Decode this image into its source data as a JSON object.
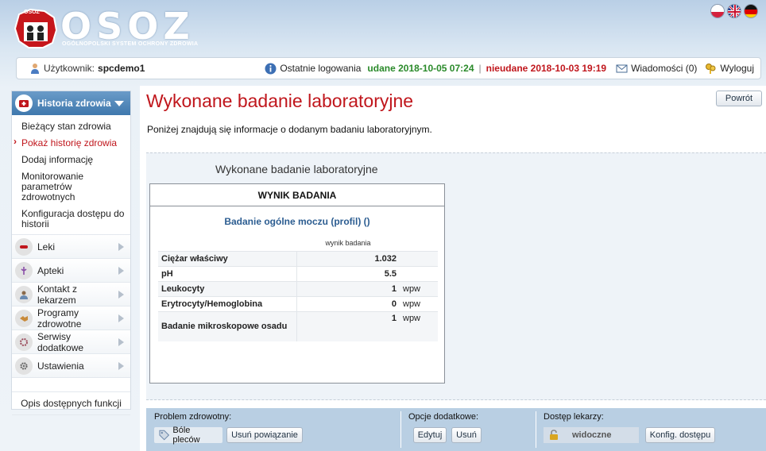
{
  "header": {
    "logo_small": "OSOZ",
    "logo_word": "OSOZ",
    "logo_subtitle": "OGÓLNOPOLSKI SYSTEM OCHRONY ZDROWIA",
    "flags": [
      "pl-flag-icon",
      "gb-flag-icon",
      "de-flag-icon"
    ]
  },
  "userbar": {
    "user_label": "Użytkownik:",
    "user_name": "spcdemo1",
    "last_login_label": "Ostatnie logowania",
    "success_login": "udane 2018-10-05 07:24",
    "separator": "|",
    "failed_login": "nieudane 2018-10-03 19:19",
    "messages": "Wiadomości (0)",
    "logout": "Wyloguj"
  },
  "sidebar": {
    "active_section": "Historia zdrowia",
    "sub_items": [
      "Bieżący stan zdrowia",
      "Pokaż historię zdrowia",
      "Dodaj informację",
      "Monitorowanie parametrów zdrowotnych",
      "Konfiguracja dostępu do historii"
    ],
    "current_sub_index": 1,
    "sections": [
      "Leki",
      "Apteki",
      "Kontakt z lekarzem",
      "Programy zdrowotne",
      "Serwisy dodatkowe",
      "Ustawienia"
    ],
    "footer": "Opis dostępnych funkcji"
  },
  "main": {
    "title": "Wykonane badanie laboratoryjne",
    "back_button": "Powrót",
    "intro": "Poniżej znajdują się informacje o dodanym badaniu laboratoryjnym.",
    "section_title": "Wykonane badanie laboratoryjne",
    "result_header": "WYNIK BADANIA",
    "test_name": "Badanie ogólne moczu (profil) ()",
    "column_header": "wynik badania",
    "rows": [
      {
        "name": "Ciężar właściwy",
        "value": "1.032",
        "unit": ""
      },
      {
        "name": "pH",
        "value": "5.5",
        "unit": ""
      },
      {
        "name": "Leukocyty",
        "value": "1",
        "unit": "wpw"
      },
      {
        "name": "Erytrocyty/Hemoglobina",
        "value": "0",
        "unit": "wpw"
      },
      {
        "name": "Badanie mikroskopowe osadu",
        "value": "1",
        "unit": "wpw"
      }
    ]
  },
  "bottom": {
    "problem_label": "Problem zdrowotny:",
    "problem_tag": "Bóle pleców",
    "unlink_button": "Usuń powiązanie",
    "options_label": "Opcje dodatkowe:",
    "edit_button": "Edytuj",
    "delete_button": "Usuń",
    "access_label": "Dostęp lekarzy:",
    "access_status": "widoczne",
    "access_config_button": "Konfig. dostępu"
  },
  "colors": {
    "accent_red": "#c0161c",
    "ok_green": "#2a8a2a",
    "link_blue": "#2c5d91",
    "sidebar_active": "#4a82b6"
  }
}
